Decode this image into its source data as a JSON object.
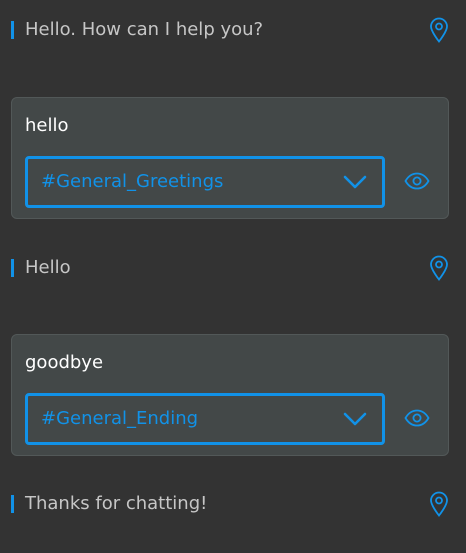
{
  "conversation": {
    "turn1_bot": {
      "text": "Hello. How can I help you?",
      "icon": "location-pin-icon"
    },
    "turn2_user": {
      "text": "hello",
      "intent": "#General_Greetings",
      "icon": "eye-icon"
    },
    "turn3_bot": {
      "text": "Hello",
      "icon": "location-pin-icon"
    },
    "turn4_user": {
      "text": "goodbye",
      "intent": "#General_Ending",
      "icon": "eye-icon"
    },
    "turn5_bot": {
      "text": "Thanks for chatting!",
      "icon": "location-pin-icon"
    }
  },
  "colors": {
    "background": "#333333",
    "card": "#434848",
    "accent": "#1192e8",
    "bot_text": "#c6c6c6",
    "user_text": "#ffffff"
  }
}
